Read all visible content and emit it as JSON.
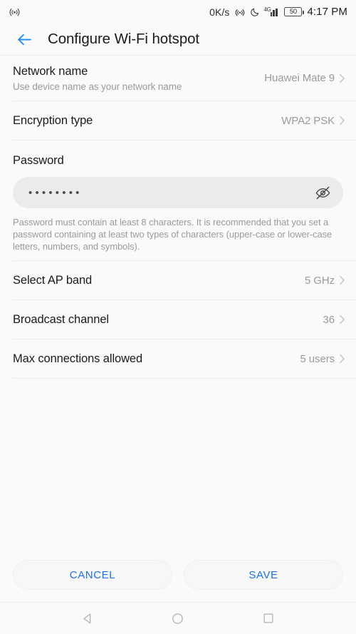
{
  "status_bar": {
    "left_icon": "hotspot-icon",
    "net_speed": "0K/s",
    "icons": [
      "hotspot-icon",
      "do-not-disturb-moon-icon",
      "signal-bars-icon"
    ],
    "network_gen": "4G",
    "battery_level": "50",
    "clock": "4:17 PM"
  },
  "app_bar": {
    "back_icon": "back-arrow-icon",
    "title": "Configure Wi-Fi hotspot",
    "accent_color": "#1a8cff"
  },
  "settings": {
    "network_name": {
      "title": "Network name",
      "subtitle": "Use device name as your network name",
      "value": "Huawei Mate 9"
    },
    "encryption": {
      "title": "Encryption type",
      "value": "WPA2 PSK"
    },
    "password": {
      "label": "Password",
      "masked_value": "••••••••",
      "visibility_icon": "eye-off-icon",
      "hint": "Password must contain at least 8 characters. It is recommended that you set a password containing at least two types of characters (upper-case or lower-case letters, numbers, and symbols)."
    },
    "ap_band": {
      "title": "Select AP band",
      "value": "5 GHz"
    },
    "broadcast_channel": {
      "title": "Broadcast channel",
      "value": "36"
    },
    "max_connections": {
      "title": "Max connections allowed",
      "value": "5 users"
    }
  },
  "footer": {
    "cancel_label": "CANCEL",
    "save_label": "SAVE",
    "link_color": "#1a73e8"
  },
  "nav_bar": {
    "back": "nav-back-triangle-icon",
    "home": "nav-home-circle-icon",
    "recents": "nav-recents-square-icon"
  }
}
